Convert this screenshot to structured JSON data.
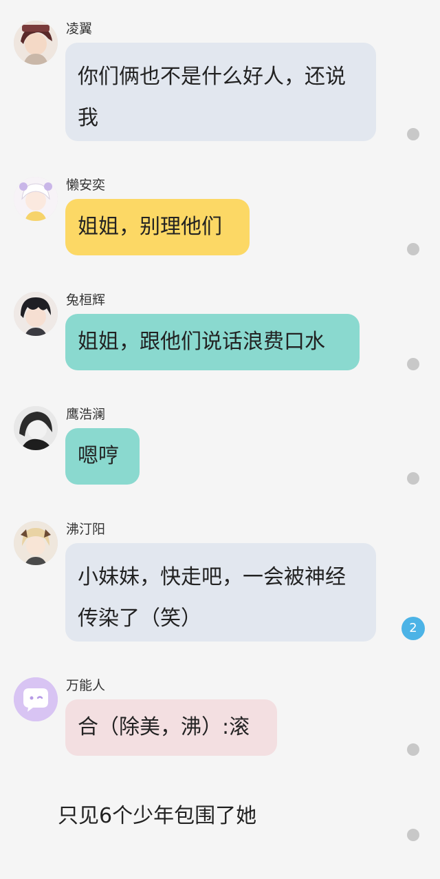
{
  "colors": {
    "background": "#f5f5f5",
    "bubble_gray": "#e2e7ef",
    "bubble_yellow": "#fcd865",
    "bubble_teal": "#8ad9cf",
    "bubble_pink": "#f3dfe1",
    "badge_blue": "#4cb3e6",
    "dot_gray": "#c8c8c8"
  },
  "messages": [
    {
      "sender": "凌翼",
      "text": "你们俩也不是什么好人，还说我",
      "avatar_icon": "avatar-dark-hair-icon"
    },
    {
      "sender": "懒安奕",
      "text": "姐姐，别理他们",
      "avatar_icon": "avatar-white-hair-icon"
    },
    {
      "sender": "兔桓辉",
      "text": "姐姐，跟他们说话浪费口水",
      "avatar_icon": "avatar-black-hair-icon"
    },
    {
      "sender": "鹰浩澜",
      "text": "嗯哼",
      "avatar_icon": "avatar-monochrome-icon"
    },
    {
      "sender": "沸汀阳",
      "text": "小妹妹，快走吧，一会被神经传染了（笑）",
      "avatar_icon": "avatar-blond-icon",
      "badge": "2"
    },
    {
      "sender": "万能人",
      "text": "合（除美，沸）:滚",
      "avatar_icon": "chat-bubble-icon"
    }
  ],
  "narration": "只见6个少年包围了她"
}
